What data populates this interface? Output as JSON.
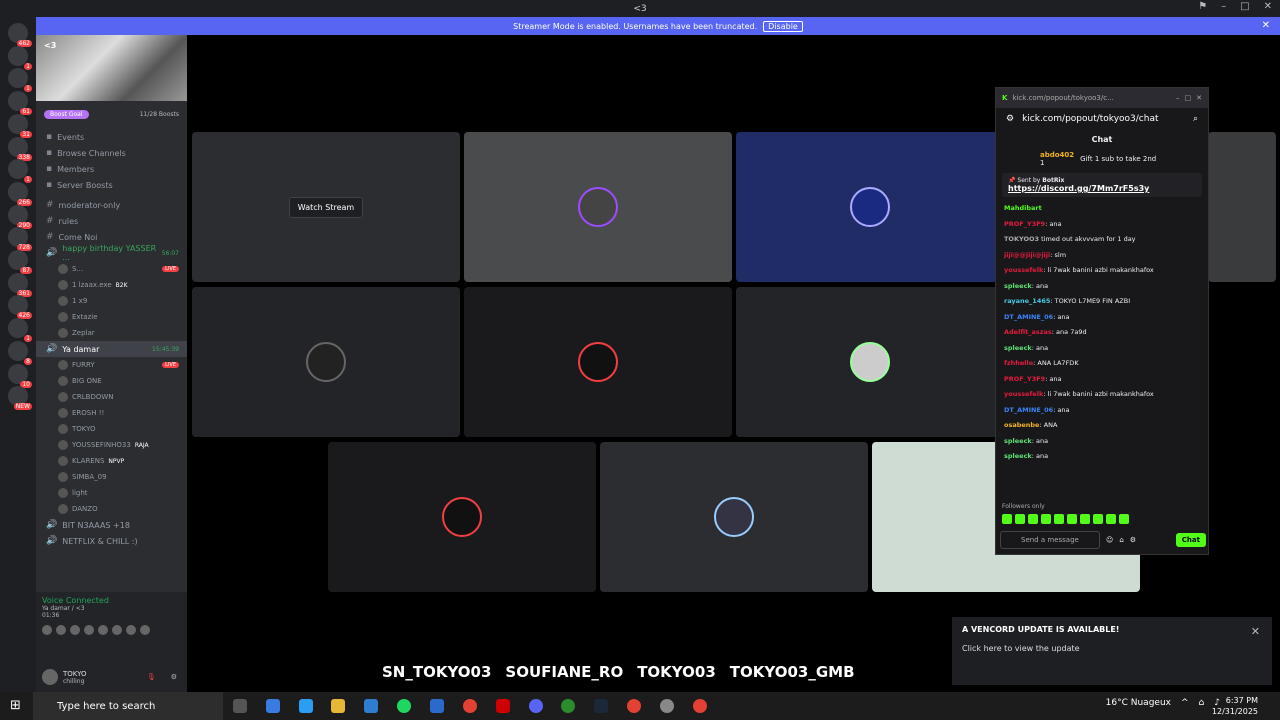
{
  "titlebar": {
    "title": "<3"
  },
  "banner": {
    "text": "Streamer Mode is enabled. Usernames have been truncated.",
    "button": "Disable"
  },
  "servers": {
    "counts": [
      "462",
      "1",
      "1",
      "61",
      "31",
      "338",
      "1",
      "266",
      "290",
      "728",
      "87",
      "361",
      "426",
      "1",
      "8",
      "10",
      "NEW"
    ]
  },
  "sidebar": {
    "server_name": "<3",
    "boost_label": "Boost Goal",
    "boost_count": "11/28 Boosts",
    "nav": [
      "Events",
      "Browse Channels",
      "Members",
      "Server Boosts"
    ],
    "channels": [
      {
        "name": "moderator-only",
        "icon": "#"
      },
      {
        "name": "rules",
        "icon": "#"
      },
      {
        "name": "Come Noi",
        "icon": "#"
      }
    ],
    "voice1": {
      "name": "happy birthday YASSER ...",
      "time": "56:07"
    },
    "voice1_users": [
      {
        "name": "S...",
        "live": "LIVE"
      },
      {
        "name": "1 lzaax.exe",
        "tag": "B2K"
      },
      {
        "name": "1 x9"
      },
      {
        "name": "Extazie"
      },
      {
        "name": "Zeplar"
      }
    ],
    "voice2": {
      "name": "Ya damar",
      "time": "15:45:39"
    },
    "voice2_users": [
      {
        "name": "FURRY",
        "live": "LIVE"
      },
      {
        "name": "BIG ONE"
      },
      {
        "name": "CRLBDOWN"
      },
      {
        "name": "EROSH !!"
      },
      {
        "name": "TOKYO"
      },
      {
        "name": "YOUSSEFINHO33",
        "tag": "RAJA"
      },
      {
        "name": "KLARENS",
        "tag": "NPVP"
      },
      {
        "name": "SIMBA_09"
      },
      {
        "name": "light"
      },
      {
        "name": "DANZO"
      }
    ],
    "more_channels": [
      "BIT N3AAAS +18",
      "NETFLIX & CHILL :)"
    ]
  },
  "voice_status": {
    "title": "Voice Connected",
    "channel": "Ya damar / <3",
    "time": "01:36"
  },
  "user": {
    "name": "TOKYO",
    "status": "chilling"
  },
  "stage": {
    "watch_label": "Watch Stream"
  },
  "popout": {
    "window_title": "kick.com/popout/tokyoo3/c...",
    "url": "kick.com/popout/tokyoo3/chat",
    "chat_title": "Chat",
    "gifter": "abdo402",
    "gifter_count": "1",
    "gift_text": "Gift 1 sub to take 2nd",
    "pinned_by": "Sent by",
    "pinned_user": "BotRix",
    "pinned_link": "https://discord.gg/7Mm7rF5s3y",
    "messages": [
      {
        "user": "Mahdibart",
        "text": "",
        "color": "#53fc18"
      },
      {
        "user": "PROF_Y3F9",
        "text": ": ana",
        "color": "#e31c3d"
      },
      {
        "user": "TOKYOO3",
        "text": " timed out akvvvam for 1 day",
        "color": "#aaaaaa"
      },
      {
        "user": "jiji@@jiji@jiji",
        "text": ": slm",
        "color": "#e31c3d"
      },
      {
        "user": "youssefelk",
        "text": ": li 7wak banini azbi makankhafox",
        "color": "#e31c3d"
      },
      {
        "user": "spleeck",
        "text": ": ana",
        "color": "#5ee373"
      },
      {
        "user": "rayane_1465",
        "text": ": TOKYO L7ME9 FIN AZBI",
        "color": "#48c8e0"
      },
      {
        "user": "DT_AMINE_06",
        "text": ": ana",
        "color": "#3a82f7"
      },
      {
        "user": "Adelfit_aszas",
        "text": ": ana 7a9d",
        "color": "#e31c3d"
      },
      {
        "user": "spleeck",
        "text": ": ana",
        "color": "#5ee373"
      },
      {
        "user": "fzhhelle",
        "text": ": ANA LA7FDK",
        "color": "#e31c3d"
      },
      {
        "user": "PROF_Y3F9",
        "text": ": ana",
        "color": "#e31c3d"
      },
      {
        "user": "youssefelk",
        "text": ": li 7wak banini azbi makankhafox",
        "color": "#e31c3d"
      },
      {
        "user": "DT_AMINE_06",
        "text": ": ana",
        "color": "#3a82f7"
      },
      {
        "user": "osabenbe",
        "text": ": ANA",
        "color": "#f0b31c"
      },
      {
        "user": "spleeck",
        "text": ": ana",
        "color": "#5ee373"
      },
      {
        "user": "spleeck",
        "text": ": ana",
        "color": "#5ee373"
      }
    ],
    "followers_only": "Followers only",
    "input_placeholder": "Send a message",
    "chat_button": "Chat"
  },
  "toast": {
    "title": "A VENCORD UPDATE IS AVAILABLE!",
    "body": "Click here to view the update"
  },
  "socials": [
    "SN_TOKYO03",
    "SOUFIANE_RO",
    "TOKYO03",
    "TOKYO03_GMB"
  ],
  "taskbar": {
    "search": "Type here to search",
    "weather": "16°C Nuageux",
    "time": "6:37 PM",
    "date": "12/31/2025"
  },
  "colors": {
    "discord_bg": "#2b2d31",
    "kick_green": "#53fc18",
    "blurple": "#5865f2"
  }
}
